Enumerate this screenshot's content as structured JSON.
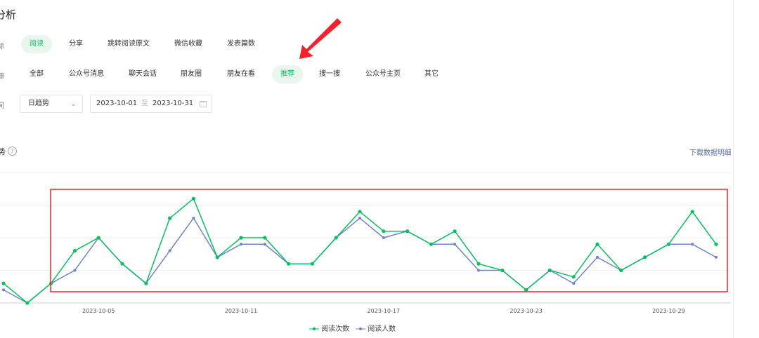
{
  "page": {
    "section_title": "分析",
    "metric_row_lead": "标",
    "metric_tabs": [
      {
        "label": "阅读",
        "active": true
      },
      {
        "label": "分享",
        "active": false
      },
      {
        "label": "跳转阅读原文",
        "active": false
      },
      {
        "label": "微信收藏",
        "active": false
      },
      {
        "label": "发表篇数",
        "active": false
      }
    ],
    "source_row_lead": "源",
    "source_tabs": [
      {
        "label": "全部",
        "active": false
      },
      {
        "label": "公众号消息",
        "active": false
      },
      {
        "label": "聊天会话",
        "active": false
      },
      {
        "label": "朋友圈",
        "active": false
      },
      {
        "label": "朋友在看",
        "active": false
      },
      {
        "label": "推荐",
        "active": true
      },
      {
        "label": "搜一搜",
        "active": false
      },
      {
        "label": "公众号主页",
        "active": false
      },
      {
        "label": "其它",
        "active": false
      }
    ],
    "time_row_lead": "间",
    "granularity": {
      "value": "日趋势",
      "icon": "chevron-down-icon"
    },
    "date_range": {
      "start": "2023-10-01",
      "separator": "至",
      "end": "2023-10-31",
      "icon": "calendar-icon"
    },
    "trend_label": "势",
    "help_icon": "?",
    "download_label": "下载数据明细",
    "annotation": {
      "arrow_color": "#f5222d",
      "box_color": "#f5222d"
    }
  },
  "chart_data": {
    "type": "line",
    "x": [
      "2023-10-01",
      "2023-10-02",
      "2023-10-03",
      "2023-10-04",
      "2023-10-05",
      "2023-10-06",
      "2023-10-07",
      "2023-10-08",
      "2023-10-09",
      "2023-10-10",
      "2023-10-11",
      "2023-10-12",
      "2023-10-13",
      "2023-10-14",
      "2023-10-15",
      "2023-10-16",
      "2023-10-17",
      "2023-10-18",
      "2023-10-19",
      "2023-10-20",
      "2023-10-21",
      "2023-10-22",
      "2023-10-23",
      "2023-10-24",
      "2023-10-25",
      "2023-10-26",
      "2023-10-27",
      "2023-10-28",
      "2023-10-29",
      "2023-10-30",
      "2023-10-31"
    ],
    "x_tick_labels": [
      "2023-10-05",
      "2023-10-11",
      "2023-10-17",
      "2023-10-23",
      "2023-10-29"
    ],
    "series": [
      {
        "name": "阅读次数",
        "color": "#07c160",
        "values": [
          8,
          5,
          8,
          13,
          15,
          11,
          8,
          18,
          21,
          12,
          15,
          15,
          11,
          11,
          15,
          19,
          16,
          16,
          14,
          16,
          11,
          10,
          7,
          10,
          9,
          14,
          10,
          12,
          14,
          19,
          14
        ]
      },
      {
        "name": "阅读人数",
        "color": "#6f83c7",
        "values": [
          7,
          5,
          8,
          10,
          15,
          11,
          8,
          13,
          18,
          12,
          14,
          14,
          11,
          11,
          15,
          18,
          15,
          16,
          14,
          14,
          10,
          10,
          7,
          10,
          8,
          12,
          10,
          12,
          14,
          14,
          12
        ]
      }
    ],
    "ylim": [
      5,
      25
    ],
    "grid": true,
    "legend_position": "bottom-center"
  }
}
